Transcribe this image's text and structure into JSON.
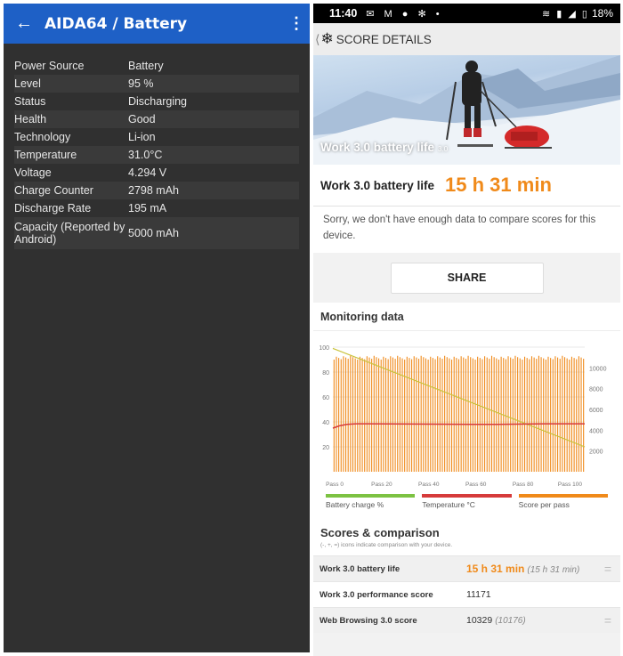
{
  "left_app": {
    "back_icon": "arrow-left-icon",
    "title": "AIDA64  /  Battery",
    "menu_icon": "more-vert-icon",
    "accent": "#1e60c6",
    "rows": [
      {
        "key": "Power Source",
        "value": "Battery"
      },
      {
        "key": "Level",
        "value": "95 %"
      },
      {
        "key": "Status",
        "value": "Discharging"
      },
      {
        "key": "Health",
        "value": "Good"
      },
      {
        "key": "Technology",
        "value": "Li-ion"
      },
      {
        "key": "Temperature",
        "value": "31.0°C"
      },
      {
        "key": "Voltage",
        "value": "4.294 V"
      },
      {
        "key": "Charge Counter",
        "value": "2798 mAh"
      },
      {
        "key": "Discharge Rate",
        "value": "195 mA"
      },
      {
        "key": "Capacity (Reported by Android)",
        "value": "5000 mAh"
      }
    ]
  },
  "right_app": {
    "status": {
      "time": "11:40",
      "battery": "18%",
      "left_icons": "message-icon gmail-icon circle-icon fan-icon dot-icon",
      "right_icons": "wifi-icon volte-icon signal-icon battery-icon"
    },
    "topbar": {
      "title": "SCORE DETAILS",
      "back_icon": "chevron-left-icon",
      "logo_icon": "snowflake-icon"
    },
    "hero": {
      "caption": "Work 3.0 battery life",
      "caption_small": "3.0"
    },
    "score": {
      "label": "Work 3.0 battery life",
      "value": "15 h 31 min",
      "accent": "#f08a1a"
    },
    "sorry_text": "Sorry, we don't have enough data to compare scores for this device.",
    "share_label": "SHARE",
    "monitoring_title": "Monitoring data",
    "legend": [
      {
        "label": "Battery charge %",
        "color": "#7cc242"
      },
      {
        "label": "Temperature °C",
        "color": "#d63b3b"
      },
      {
        "label": "Score per pass",
        "color": "#f08a1a"
      }
    ],
    "scores_title": "Scores & comparison",
    "scores_note": "(-, +, =) icons indicate comparison with your device.",
    "score_rows": [
      {
        "name": "Work 3.0 battery life",
        "score": "15 h 31 min",
        "compare": "(15 h 31 min)",
        "eq": "="
      },
      {
        "name": "Work 3.0 performance score",
        "score": "11171",
        "compare": "",
        "eq": ""
      },
      {
        "name": "Web Browsing 3.0 score",
        "score": "10329",
        "compare": "(10176)",
        "eq": "="
      }
    ]
  },
  "chart_data": {
    "type": "line",
    "x_ticks": [
      "Pass 0",
      "Pass 20",
      "Pass 40",
      "Pass 60",
      "Pass 80",
      "Pass 100"
    ],
    "y_left_ticks": [
      "20",
      "40",
      "60",
      "80",
      "100"
    ],
    "y_right_ticks": [
      "2000",
      "4000",
      "6000",
      "8000",
      "10000"
    ],
    "y_left_lim": [
      0,
      100
    ],
    "y_right_lim": [
      0,
      12000
    ],
    "x_lim": [
      0,
      107
    ],
    "series": [
      {
        "name": "Battery charge %",
        "axis": "left",
        "color": "#c9c23a",
        "x": [
          0,
          107
        ],
        "y": [
          99,
          20
        ]
      },
      {
        "name": "Temperature °C",
        "axis": "left",
        "color": "#d63b3b",
        "x": [
          0,
          3,
          6,
          10,
          15,
          60,
          70,
          90,
          107
        ],
        "y": [
          35,
          37,
          38,
          38.5,
          38.5,
          38,
          38,
          38.5,
          38.5
        ]
      },
      {
        "name": "Score per pass",
        "axis": "right",
        "color": "#f08a1a",
        "bar_count": 107,
        "y_approx": 11000,
        "y_range": [
          10800,
          11200
        ]
      }
    ]
  }
}
